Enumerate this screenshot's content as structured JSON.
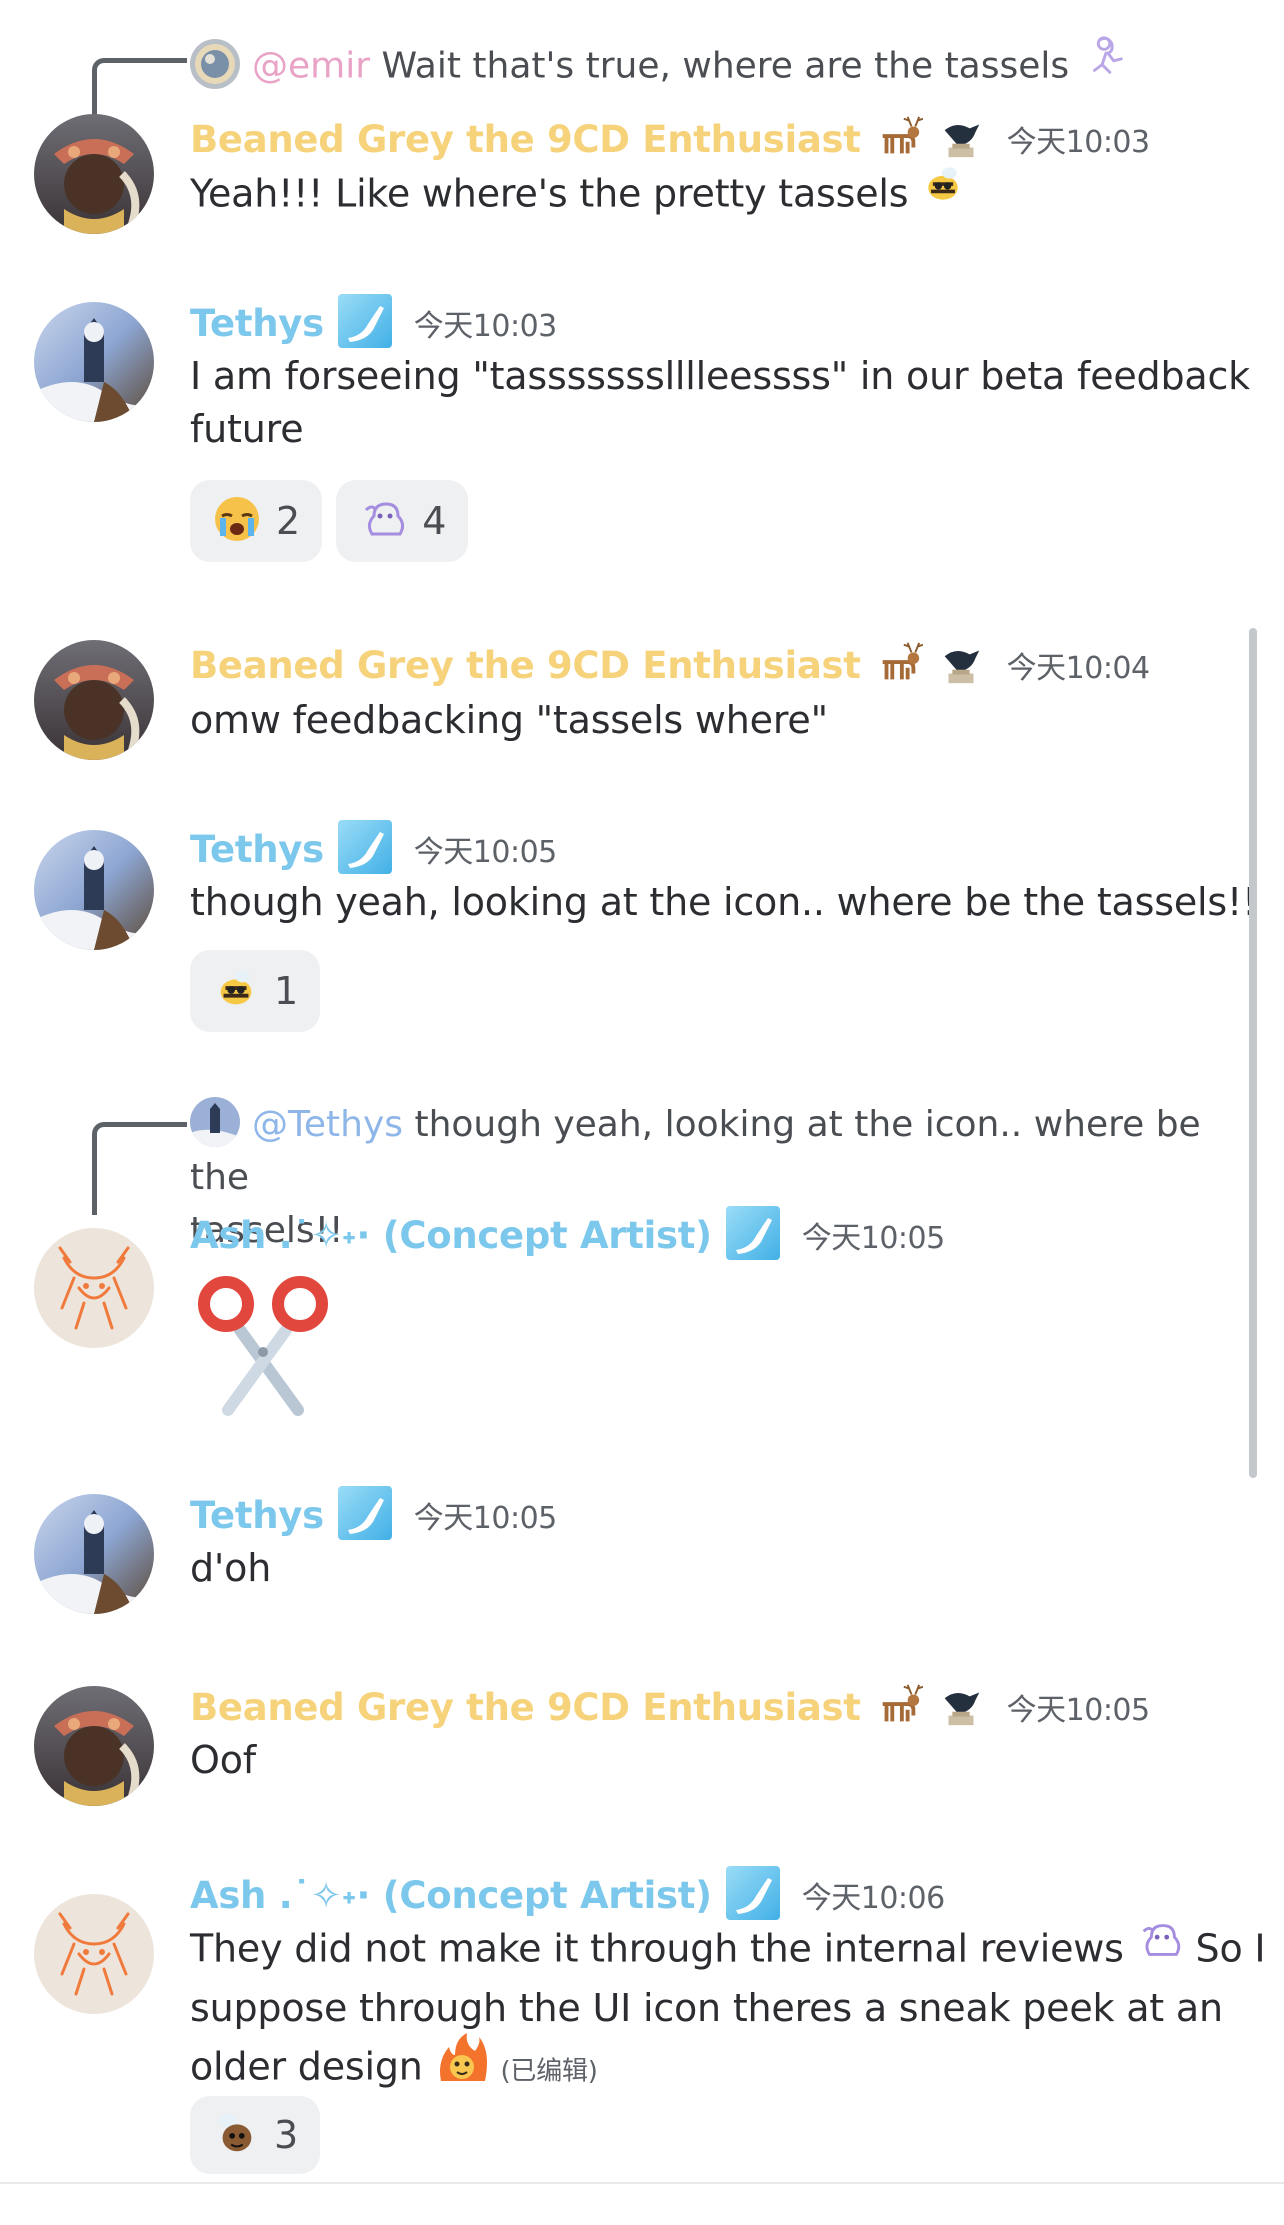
{
  "reply_1": {
    "mention": "@emir",
    "text": "Wait that's true, where are the tassels"
  },
  "messages": [
    {
      "author": "Beaned Grey the 9CD Enthusiast",
      "time": "今天10:03",
      "text": "Yeah!!! Like where's the pretty tassels"
    },
    {
      "author": "Tethys",
      "time": "今天10:03",
      "line1": "I am forseeing \"tassssssslllleessss\" in our beta feedback",
      "line2": "future",
      "reactions": [
        {
          "emoji": "crying-face",
          "count": "2"
        },
        {
          "emoji": "ghost-sticker",
          "count": "4"
        }
      ]
    },
    {
      "author": "Beaned Grey the 9CD Enthusiast",
      "time": "今天10:04",
      "text": "omw feedbacking \"tassels where\""
    },
    {
      "author": "Tethys",
      "time": "今天10:05",
      "text": "though yeah, looking at the icon.. where be the tassels!!",
      "reactions": [
        {
          "emoji": "bee",
          "count": "1"
        }
      ]
    },
    {
      "author": "Ash .˙✧˖· (Concept Artist)",
      "time": "今天10:05",
      "text": "✂️"
    },
    {
      "author": "Tethys",
      "time": "今天10:05",
      "text": "d'oh"
    },
    {
      "author": "Beaned Grey the 9CD Enthusiast",
      "time": "今天10:05",
      "text": "Oof"
    },
    {
      "author": "Ash .˙✧˖· (Concept Artist)",
      "time": "今天10:06",
      "line1_a": "They did not make it through the internal reviews",
      "line1_b": "So I",
      "line2": "suppose through the UI icon theres a sneak peek at an",
      "line3": "older design",
      "edited": "(已编辑)",
      "reactions": [
        {
          "emoji": "bee-face",
          "count": "3"
        }
      ]
    }
  ],
  "reply_2": {
    "mention": "@Tethys",
    "text_line1": "though yeah, looking at the icon.. where be the",
    "text_line2": "tassels!!"
  },
  "colors": {
    "gold_name": "#f6d27b",
    "blue_name": "#7cc7ec",
    "mention_blue": "#8fb6e8",
    "mention_pink": "#e8a3c6",
    "reaction_bg": "#eef0f2"
  }
}
